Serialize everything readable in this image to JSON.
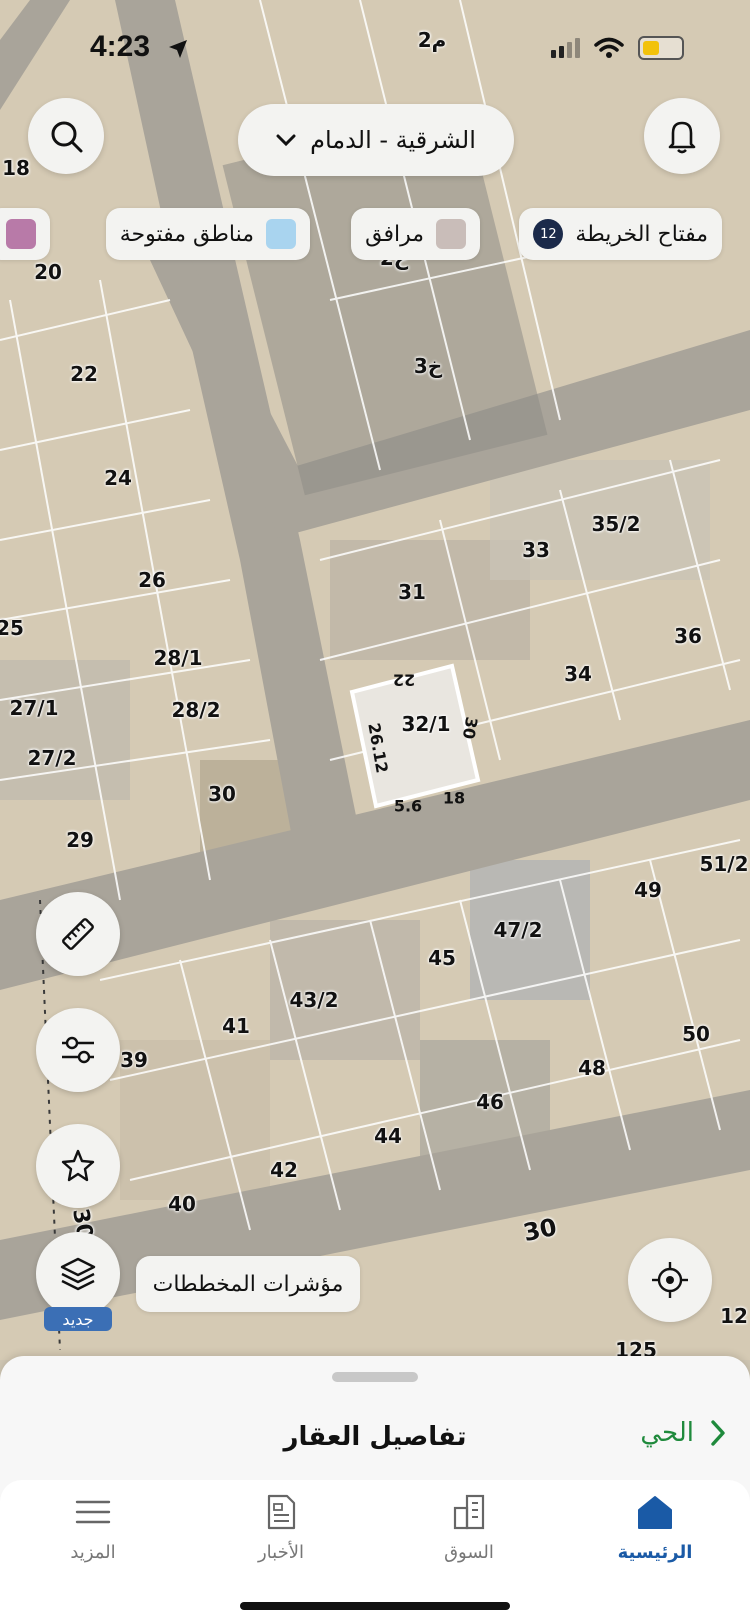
{
  "status_bar": {
    "time": "4:23"
  },
  "header": {
    "location": "الشرقية - الدمام",
    "search_icon": "search-icon",
    "notifications_icon": "bell-icon"
  },
  "legend": [
    {
      "label": "مفتاح الخريطة",
      "badge": "12"
    },
    {
      "label": "مرافق",
      "color": "#c9bdb9"
    },
    {
      "label": "مناطق مفتوحة",
      "color": "#a9d4ef"
    },
    {
      "label": "",
      "color": "#b87aa8"
    }
  ],
  "map": {
    "plots": [
      "2م",
      "18",
      "2خ",
      "3خ",
      "20",
      "22",
      "24",
      "26",
      "25",
      "28/1",
      "27/1",
      "28/2",
      "27/2",
      "30",
      "29",
      "31",
      "33",
      "35/2",
      "36",
      "34",
      "32/1",
      "49",
      "51/2",
      "47/2",
      "45",
      "43/2",
      "41",
      "39",
      "50",
      "48",
      "46",
      "44",
      "42",
      "40",
      "30",
      "30",
      "125",
      "12"
    ],
    "dimensions": [
      "22",
      "26.12",
      "30",
      "18",
      "5.6"
    ],
    "selected_plot": "32/1"
  },
  "controls": {
    "ruler_icon": "ruler-icon",
    "filter_icon": "sliders-icon",
    "favorite_icon": "star-icon",
    "layers_icon": "layers-icon",
    "new_badge": "جديد",
    "plan_indicators": "مؤشرات المخططات",
    "locate_icon": "crosshair-icon"
  },
  "sheet": {
    "title": "تفاصيل العقار",
    "district_link": "الحي"
  },
  "tabs": [
    {
      "label": "الرئيسية",
      "icon": "home-icon",
      "active": true
    },
    {
      "label": "السوق",
      "icon": "buildings-icon",
      "active": false
    },
    {
      "label": "الأخبار",
      "icon": "news-icon",
      "active": false
    },
    {
      "label": "المزيد",
      "icon": "menu-icon",
      "active": false
    }
  ],
  "colors": {
    "accent": "#1a5aa6",
    "link": "#1f8a3c"
  }
}
